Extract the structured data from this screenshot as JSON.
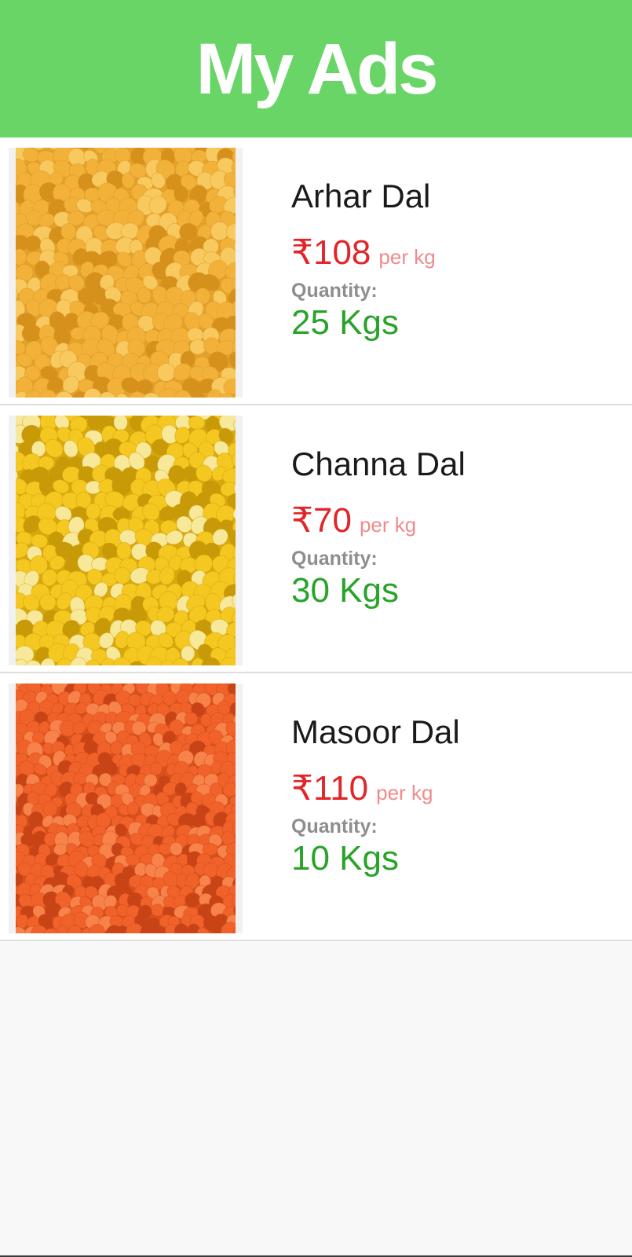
{
  "header": {
    "title": "My Ads"
  },
  "ads": [
    {
      "name": "Arhar Dal",
      "price": "₹108",
      "unit": "per kg",
      "quantity_label": "Quantity:",
      "quantity": "25 Kgs",
      "image": "arhar-dal-image",
      "colors": {
        "grain": "#f2b23a",
        "grain_light": "#f7c95e",
        "grain_dark": "#d6901c",
        "bg": "#e3a22c"
      }
    },
    {
      "name": "Channa Dal",
      "price": "₹70",
      "unit": "per kg",
      "quantity_label": "Quantity:",
      "quantity": "30 Kgs",
      "image": "channa-dal-image",
      "colors": {
        "grain": "#f4c820",
        "grain_light": "#f8e89a",
        "grain_dark": "#c99a07",
        "bg": "#d9a80f"
      }
    },
    {
      "name": "Masoor Dal",
      "price": "₹110",
      "unit": "per kg",
      "quantity_label": "Quantity:",
      "quantity": "10 Kgs",
      "image": "masoor-dal-image",
      "colors": {
        "grain": "#f0622a",
        "grain_light": "#f8834a",
        "grain_dark": "#c84416",
        "bg": "#d9501d"
      }
    }
  ],
  "theme": {
    "header_bg": "#69d566",
    "price_color": "#e0262a",
    "quantity_color": "#29a329"
  }
}
